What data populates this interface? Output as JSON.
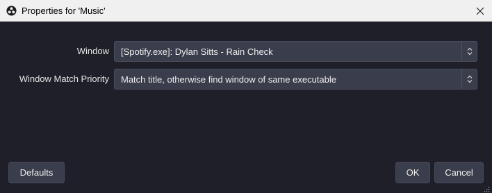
{
  "window": {
    "title": "Properties for 'Music'"
  },
  "icons": {
    "app": "obs-logo-icon",
    "close": "close-icon",
    "combo_arrow": "updown-chevron-icon",
    "resize": "resize-grip-icon"
  },
  "form": {
    "window_label": "Window",
    "window_value": "[Spotify.exe]: Dylan Sitts - Rain Check",
    "priority_label": "Window Match Priority",
    "priority_value": "Match title, otherwise find window of same executable"
  },
  "buttons": {
    "defaults": "Defaults",
    "ok": "OK",
    "cancel": "Cancel"
  },
  "colors": {
    "background": "#1e1f29",
    "control": "#3a3d4b",
    "titlebar": "#f0f0f0"
  }
}
